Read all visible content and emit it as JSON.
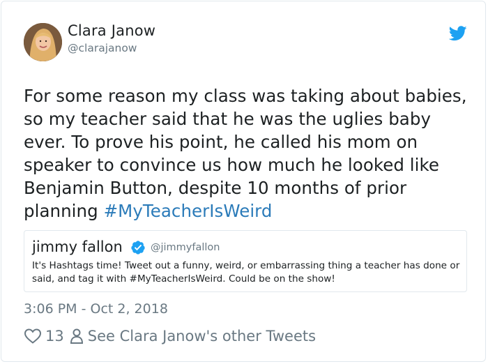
{
  "tweet": {
    "author_name": "Clara Janow",
    "author_handle": "@clarajanow",
    "text": "For some reason my class was taking about babies, so my teacher said that he was the uglies baby ever. To prove his point, he called his mom on speaker to convince us how much he looked like Benjamin Button, despite 10 months of prior planning ",
    "hashtag": "#MyTeacherIsWeird",
    "timestamp": "3:06 PM - Oct 2, 2018",
    "like_count": "13",
    "other_tweets_link": "See Clara Janow's other Tweets"
  },
  "quoted_tweet": {
    "author_name": "jimmy fallon",
    "author_handle": "@jimmyfallon",
    "verified": true,
    "text": "It's Hashtags time! Tweet out a funny, weird, or embarrassing thing a teacher has done or said, and tag it with #MyTeacherIsWeird. Could be on the show!"
  },
  "icons": {
    "brand": "twitter-bird-icon",
    "verified": "verified-badge-icon",
    "like": "heart-icon",
    "profile": "person-icon"
  },
  "colors": {
    "brand_blue": "#1da1f2",
    "link_blue": "#2b7bb9",
    "secondary_text": "#697882",
    "border": "#e1e8ed"
  }
}
